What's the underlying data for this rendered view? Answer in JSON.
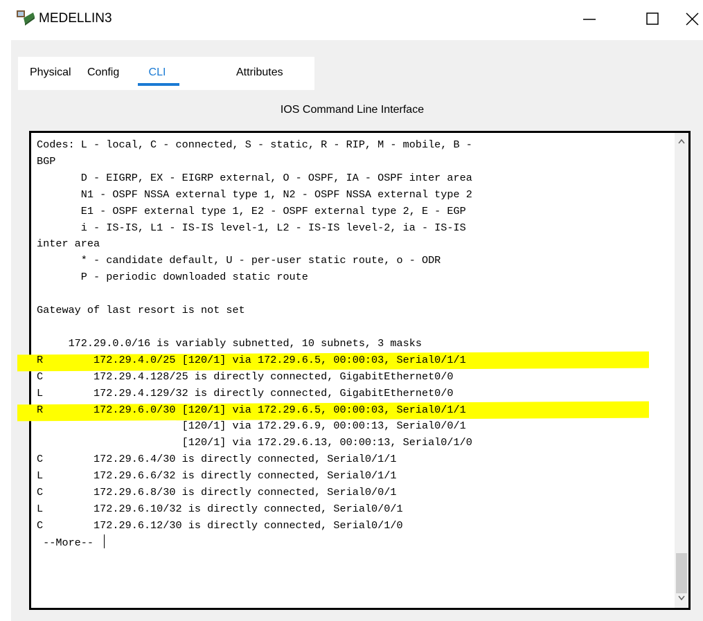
{
  "window": {
    "title": "MEDELLIN3",
    "icon": "router-laptop-icon"
  },
  "tabs": [
    {
      "label": "Physical",
      "active": false
    },
    {
      "label": "Config",
      "active": false
    },
    {
      "label": "CLI",
      "active": true
    },
    {
      "label": "Attributes",
      "active": false
    }
  ],
  "cli": {
    "header": "IOS Command Line Interface",
    "more_prompt": "--More--",
    "highlight_color": "#ffff00",
    "lines": [
      {
        "text": "Codes: L - local, C - connected, S - static, R - RIP, M - mobile, B -",
        "highlight": false
      },
      {
        "text": "BGP",
        "highlight": false
      },
      {
        "text": "       D - EIGRP, EX - EIGRP external, O - OSPF, IA - OSPF inter area",
        "highlight": false
      },
      {
        "text": "       N1 - OSPF NSSA external type 1, N2 - OSPF NSSA external type 2",
        "highlight": false
      },
      {
        "text": "       E1 - OSPF external type 1, E2 - OSPF external type 2, E - EGP",
        "highlight": false
      },
      {
        "text": "       i - IS-IS, L1 - IS-IS level-1, L2 - IS-IS level-2, ia - IS-IS",
        "highlight": false
      },
      {
        "text": "inter area",
        "highlight": false
      },
      {
        "text": "       * - candidate default, U - per-user static route, o - ODR",
        "highlight": false
      },
      {
        "text": "       P - periodic downloaded static route",
        "highlight": false
      },
      {
        "text": "",
        "highlight": false
      },
      {
        "text": "Gateway of last resort is not set",
        "highlight": false
      },
      {
        "text": "",
        "highlight": false
      },
      {
        "text": "     172.29.0.0/16 is variably subnetted, 10 subnets, 3 masks",
        "highlight": false
      },
      {
        "text": "R        172.29.4.0/25 [120/1] via 172.29.6.5, 00:00:03, Serial0/1/1",
        "highlight": true
      },
      {
        "text": "C        172.29.4.128/25 is directly connected, GigabitEthernet0/0",
        "highlight": false
      },
      {
        "text": "L        172.29.4.129/32 is directly connected, GigabitEthernet0/0",
        "highlight": false
      },
      {
        "text": "R        172.29.6.0/30 [120/1] via 172.29.6.5, 00:00:03, Serial0/1/1",
        "highlight": true
      },
      {
        "text": "                       [120/1] via 172.29.6.9, 00:00:13, Serial0/0/1",
        "highlight": false
      },
      {
        "text": "                       [120/1] via 172.29.6.13, 00:00:13, Serial0/1/0",
        "highlight": false
      },
      {
        "text": "C        172.29.6.4/30 is directly connected, Serial0/1/1",
        "highlight": false
      },
      {
        "text": "L        172.29.6.6/32 is directly connected, Serial0/1/1",
        "highlight": false
      },
      {
        "text": "C        172.29.6.8/30 is directly connected, Serial0/0/1",
        "highlight": false
      },
      {
        "text": "L        172.29.6.10/32 is directly connected, Serial0/0/1",
        "highlight": false
      },
      {
        "text": "C        172.29.6.12/30 is directly connected, Serial0/1/0",
        "highlight": false
      }
    ]
  }
}
